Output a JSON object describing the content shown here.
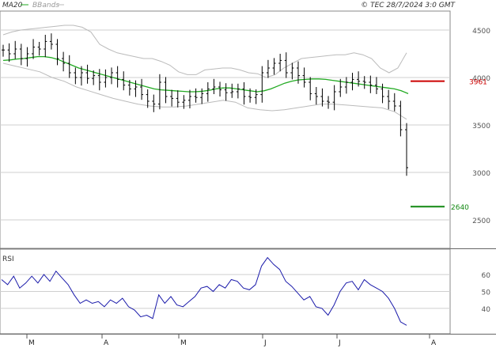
{
  "header": {
    "ma_label": "MA20",
    "bb_label": "BBands",
    "source": "© TEC 28/7/2024 3:0 GMT"
  },
  "colors": {
    "ma": "#22aa22",
    "bands": "#bbbbbb",
    "bars": "#000000",
    "resistance": "#cc0000",
    "support": "#118811",
    "rsi": "#1a1aaa",
    "grid": "#cfcfcf"
  },
  "chart_data": [
    {
      "type": "line",
      "subtype": "ohlc",
      "title": "",
      "xlabel": "",
      "ylabel": "",
      "ylim": [
        2200,
        4700
      ],
      "y_ticks": [
        "4500",
        "4000",
        "3500",
        "3000",
        "2500"
      ],
      "x_ticks": [
        "M",
        "A",
        "M",
        "J",
        "J",
        "A"
      ],
      "grid": true,
      "legend": "top-left",
      "levels": [
        {
          "name": "resistance",
          "value": 3961,
          "label": "3961"
        },
        {
          "name": "support",
          "value": 2640,
          "label": "2640"
        }
      ],
      "close": [
        4290,
        4250,
        4300,
        4200,
        4250,
        4320,
        4300,
        4380,
        4350,
        4200,
        4150,
        4050,
        4000,
        4050,
        3990,
        4020,
        3950,
        4000,
        4050,
        3980,
        3920,
        3880,
        3900,
        3820,
        3750,
        3720,
        3950,
        3800,
        3780,
        3740,
        3760,
        3800,
        3790,
        3830,
        3880,
        3900,
        3870,
        3840,
        3850,
        3880,
        3800,
        3790,
        3820,
        4050,
        4100,
        4150,
        4180,
        4050,
        4100,
        4020,
        3950,
        3830,
        3800,
        3750,
        3740,
        3850,
        3900,
        3950,
        3980,
        3960,
        3950,
        3920,
        3880,
        3800,
        3750,
        3700,
        3450,
        3050
      ],
      "ma20": [
        4180,
        4185,
        4195,
        4200,
        4210,
        4220,
        4220,
        4210,
        4190,
        4160,
        4130,
        4100,
        4080,
        4060,
        4040,
        4020,
        4000,
        3980,
        3960,
        3940,
        3920,
        3900,
        3880,
        3870,
        3865,
        3860,
        3855,
        3850,
        3850,
        3855,
        3865,
        3880,
        3890,
        3890,
        3880,
        3870,
        3860,
        3850,
        3860,
        3880,
        3910,
        3940,
        3960,
        3975,
        3980,
        3985,
        3985,
        3980,
        3970,
        3960,
        3950,
        3940,
        3930,
        3920,
        3910,
        3900,
        3890,
        3880,
        3860,
        3830
      ],
      "bb_upper": [
        4450,
        4480,
        4500,
        4510,
        4520,
        4530,
        4540,
        4550,
        4550,
        4530,
        4480,
        4350,
        4300,
        4260,
        4240,
        4220,
        4200,
        4200,
        4170,
        4130,
        4060,
        4030,
        4030,
        4080,
        4090,
        4100,
        4100,
        4080,
        4050,
        4040,
        4000,
        4030,
        4100,
        4150,
        4200,
        4210,
        4220,
        4230,
        4240,
        4240,
        4260,
        4240,
        4200,
        4100,
        4050,
        4100,
        4260
      ],
      "bb_lower": [
        4150,
        4120,
        4090,
        4060,
        4000,
        3960,
        3900,
        3860,
        3820,
        3780,
        3750,
        3720,
        3700,
        3690,
        3690,
        3700,
        3720,
        3740,
        3760,
        3740,
        3680,
        3660,
        3650,
        3660,
        3680,
        3700,
        3720,
        3720,
        3710,
        3700,
        3690,
        3680,
        3640,
        3560
      ]
    },
    {
      "type": "line",
      "title": "RSI",
      "xlabel": "",
      "ylabel": "",
      "ylim": [
        25,
        75
      ],
      "y_ticks": [
        "60",
        "50",
        "40"
      ],
      "grid": true,
      "values": [
        57,
        54,
        59,
        52,
        55,
        59,
        55,
        60,
        56,
        62,
        58,
        54,
        48,
        43,
        45,
        43,
        44,
        41,
        45,
        43,
        46,
        41,
        39,
        35,
        36,
        34,
        48,
        43,
        47,
        42,
        41,
        44,
        47,
        52,
        53,
        50,
        54,
        52,
        57,
        56,
        52,
        51,
        54,
        65,
        70,
        66,
        63,
        56,
        53,
        49,
        45,
        47,
        41,
        40,
        36,
        42,
        50,
        55,
        56,
        51,
        57,
        54,
        52,
        50,
        46,
        40,
        32,
        30
      ]
    }
  ]
}
